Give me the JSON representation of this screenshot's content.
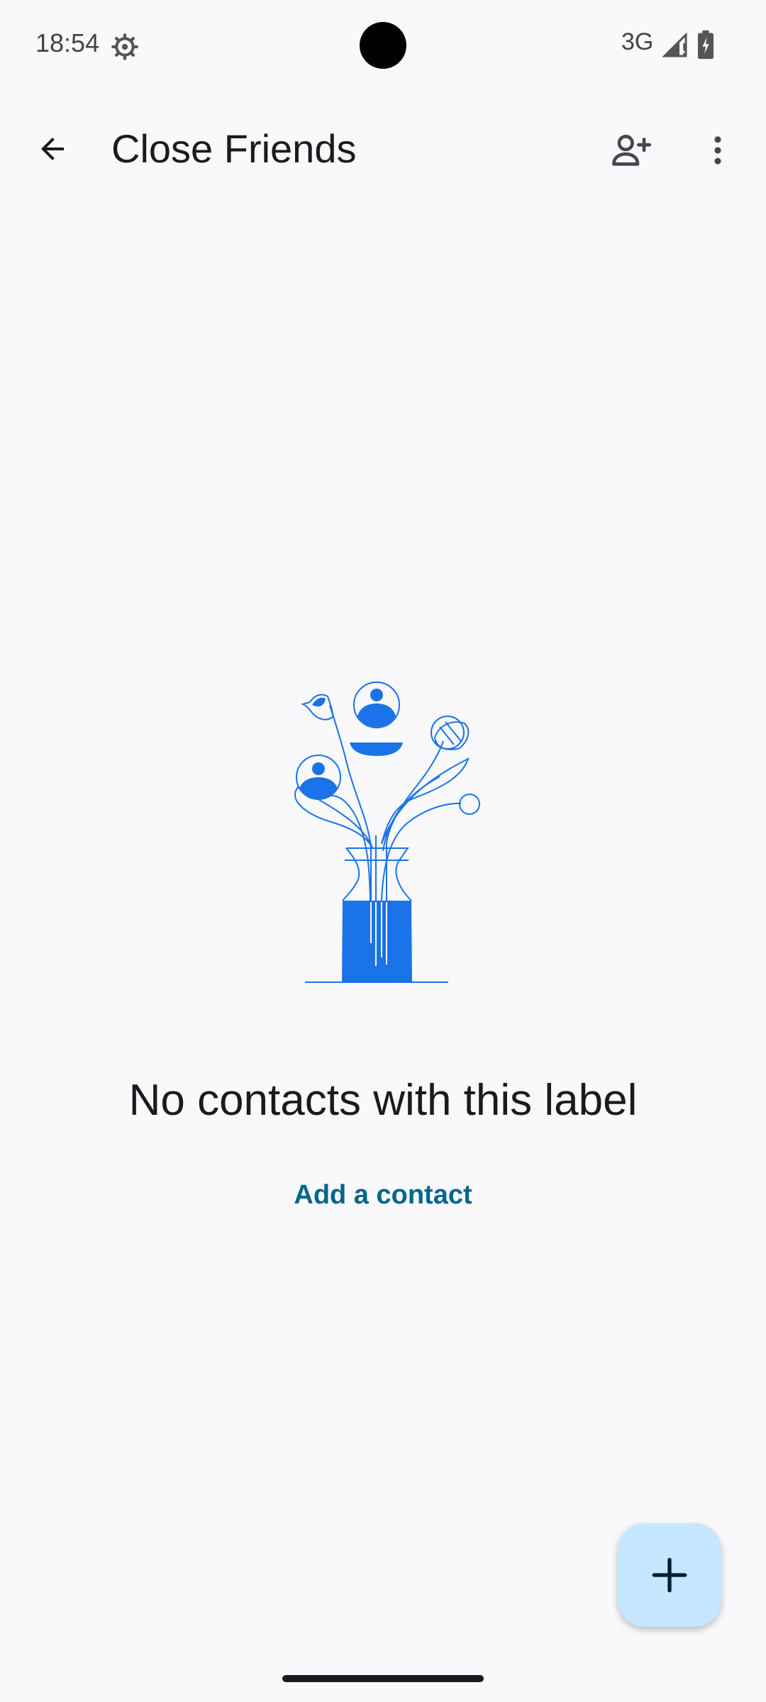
{
  "status_bar": {
    "time": "18:54",
    "network": "3G",
    "icons": [
      "gear-icon",
      "signal-icon",
      "battery-icon"
    ]
  },
  "app_bar": {
    "title": "Close Friends",
    "icons": [
      "back-arrow-icon",
      "add-person-icon",
      "more-vert-icon"
    ]
  },
  "empty_state": {
    "title": "No contacts with this label",
    "action_label": "Add a contact"
  },
  "fab": {
    "icon": "plus-icon"
  },
  "colors": {
    "background": "#f9f9fc",
    "accent": "#1a73e8",
    "link": "#00668b",
    "fab": "#c5e7ff",
    "text": "#1b1b1f"
  }
}
